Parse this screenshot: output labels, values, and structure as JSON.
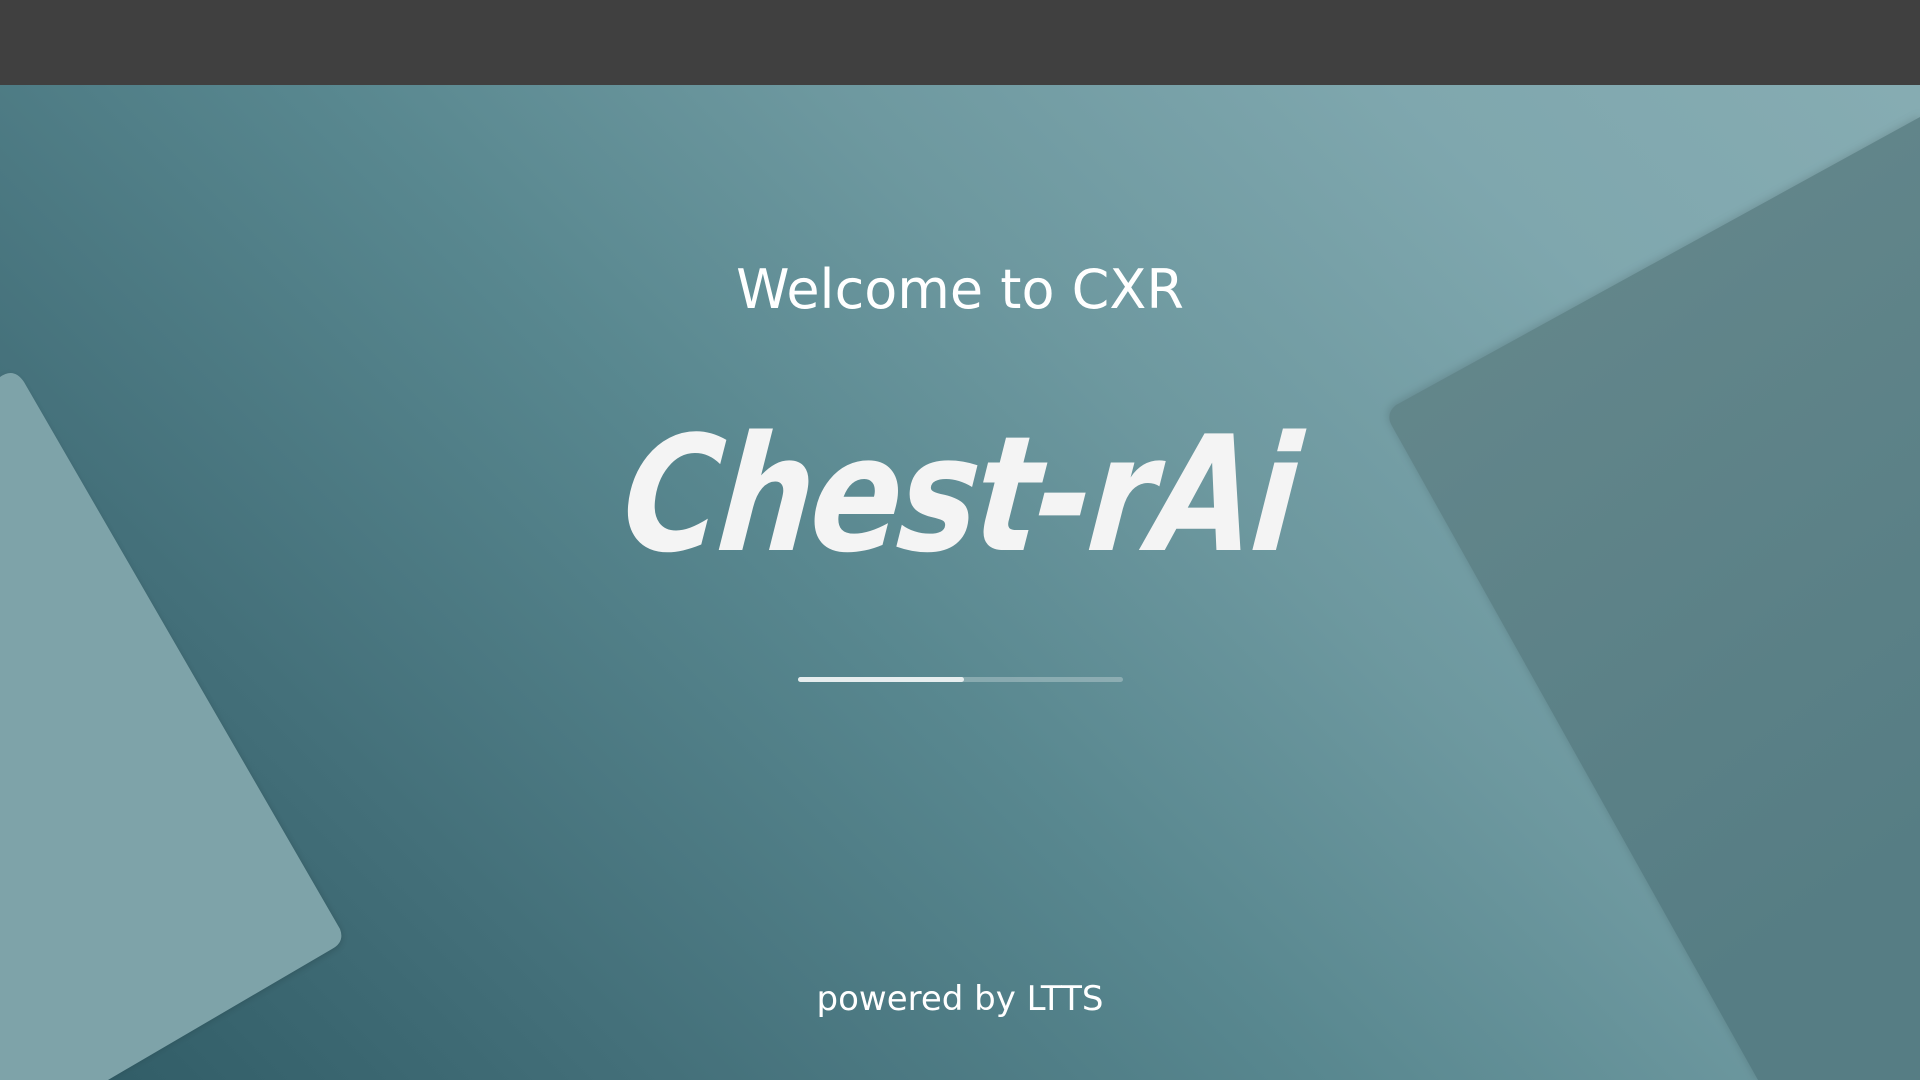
{
  "top_bar": {
    "color": "#404040"
  },
  "splash": {
    "welcome_text": "Welcome to CXR",
    "logo_text": "Chest-rAi",
    "footer_text": "powered by LTTS"
  },
  "loading": {
    "progress_fraction": 0.51
  },
  "colors": {
    "gradient_light": "#86acb2",
    "gradient_dark": "#2e5a64",
    "text": "#ffffff"
  }
}
